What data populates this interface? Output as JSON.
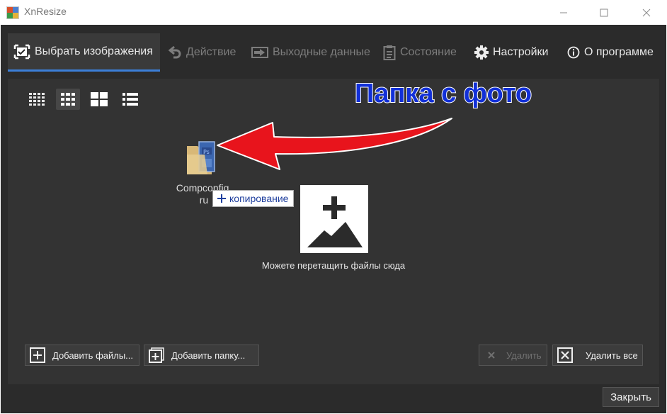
{
  "window": {
    "title": "XnResize",
    "controls": [
      "minimize",
      "maximize",
      "close"
    ]
  },
  "tabs": [
    {
      "label": "Выбрать изображения",
      "icon": "image-select-icon",
      "state": "active"
    },
    {
      "label": "Действие",
      "icon": "undo-arrow-icon",
      "state": "disabled"
    },
    {
      "label": "Выходные данные",
      "icon": "output-arrow-icon",
      "state": "disabled"
    },
    {
      "label": "Состояние",
      "icon": "clipboard-icon",
      "state": "disabled"
    },
    {
      "label": "Настройки",
      "icon": "gear-icon",
      "state": "normal"
    },
    {
      "label": "О программе",
      "icon": "info-icon",
      "state": "normal"
    }
  ],
  "view_modes": [
    "small-grid-icon",
    "medium-grid-icon",
    "large-grid-icon",
    "list-icon"
  ],
  "active_view_mode": "medium-grid-icon",
  "drag_item": {
    "name_line1": "Compconfig.",
    "name_line2": "ru",
    "tooltip": "копирование"
  },
  "drop_zone": {
    "caption": "Можете перетащить файлы сюда"
  },
  "annotation": {
    "text": "Папка с фото",
    "color": "#1230d8",
    "arrow_color": "#e8141c"
  },
  "buttons": {
    "add_files": "Добавить файлы...",
    "add_folder": "Добавить папку...",
    "delete": "Удалить",
    "delete_all": "Удалить все",
    "close": "Закрыть"
  },
  "colors": {
    "background": "#2b2b2b",
    "panel": "#333333",
    "accent": "#3c7fd8"
  }
}
